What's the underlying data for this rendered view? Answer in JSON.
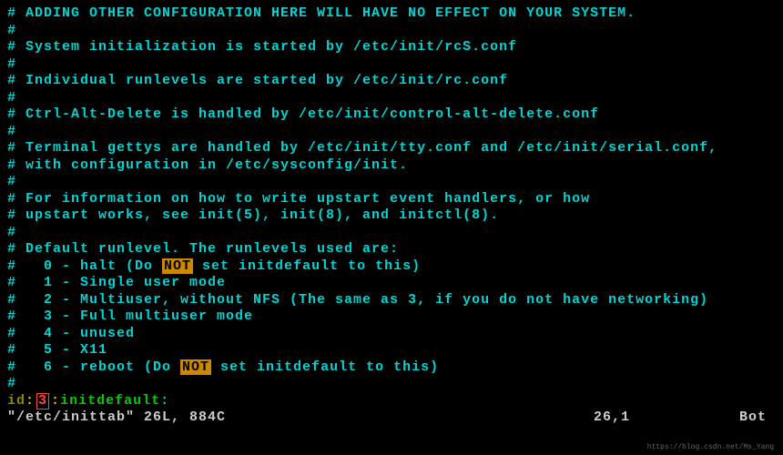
{
  "lines": {
    "l0": "# ADDING OTHER CONFIGURATION HERE WILL HAVE NO EFFECT ON YOUR SYSTEM.",
    "l1": "#",
    "l2": "# System initialization is started by /etc/init/rcS.conf",
    "l3": "#",
    "l4": "# Individual runlevels are started by /etc/init/rc.conf",
    "l5": "#",
    "l6": "# Ctrl-Alt-Delete is handled by /etc/init/control-alt-delete.conf",
    "l7": "#",
    "l8": "# Terminal gettys are handled by /etc/init/tty.conf and /etc/init/serial.conf,",
    "l9": "# with configuration in /etc/sysconfig/init.",
    "l10": "#",
    "l11": "# For information on how to write upstart event handlers, or how",
    "l12": "# upstart works, see init(5), init(8), and initctl(8).",
    "l13": "#",
    "l14": "# Default runlevel. The runlevels used are:",
    "rl0a": "#   0 - halt (Do ",
    "rl0b": " set initdefault to this)",
    "rl1": "#   1 - Single user mode",
    "rl2": "#   2 - Multiuser, without NFS (The same as 3, if you do not have networking)",
    "rl3": "#   3 - Full multiuser mode",
    "rl4": "#   4 - unused",
    "rl5": "#   5 - X11",
    "rl6a": "#   6 - reboot (Do ",
    "rl6b": " set initdefault to this)",
    "l22": "#",
    "not": "NOT"
  },
  "id_line": {
    "label": "id",
    "runlevel": "3",
    "colon": ":",
    "action": "initdefault"
  },
  "status": {
    "file_info": "\"/etc/inittab\" 26L, 884C",
    "cursor_pos": "26,1",
    "scroll_pos": "Bot"
  },
  "watermark": "https://blog.csdn.net/Ms_Yang"
}
